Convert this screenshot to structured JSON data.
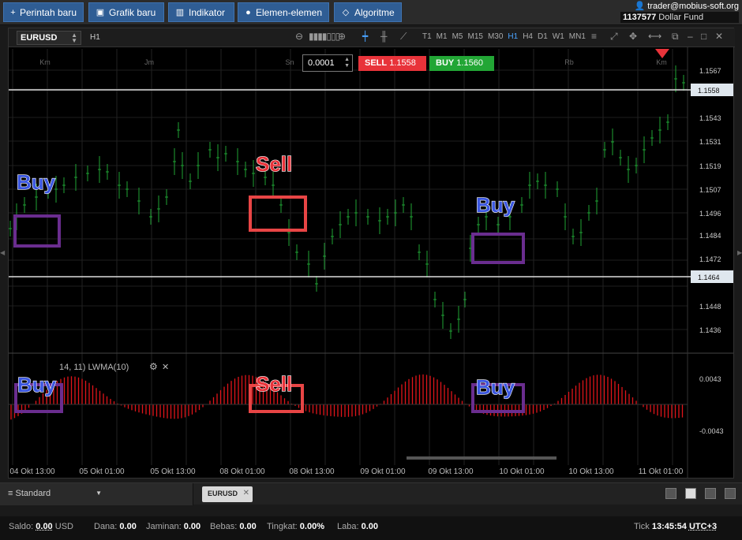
{
  "toolbar": {
    "buttons": [
      {
        "label": "Perintah baru",
        "icon": "plus-icon"
      },
      {
        "label": "Grafik baru",
        "icon": "chart-icon"
      },
      {
        "label": "Indikator",
        "icon": "bars-icon"
      },
      {
        "label": "Elemen-elemen",
        "icon": "shapes-icon"
      },
      {
        "label": "Algoritme",
        "icon": "diamond-icon"
      }
    ]
  },
  "account": {
    "email": "trader@mobius-soft.org",
    "number": "1137577",
    "fund": "Dollar Fund"
  },
  "chart": {
    "symbol": "EURUSD",
    "timeframe": "H1",
    "timeframes": [
      "T1",
      "M1",
      "M5",
      "M15",
      "M30",
      "H1",
      "H4",
      "D1",
      "W1",
      "MN1"
    ],
    "active_timeframe": "H1",
    "lot": "0.0001",
    "sell_label": "SELL",
    "sell_price": "1.1558",
    "buy_label": "BUY",
    "buy_price": "1.1560",
    "day_labels": [
      "Km",
      "Jm",
      "Sn",
      "Rb",
      "Km"
    ],
    "price_ticks": [
      "1.1567",
      "1.1543",
      "1.1531",
      "1.1519",
      "1.1507",
      "1.1496",
      "1.1484",
      "1.1472",
      "1.1448",
      "1.1436"
    ],
    "hline_upper": "1.1558",
    "hline_lower": "1.1464",
    "indicator_label": "14, 11) LWMA(10)",
    "indicator_ticks": [
      "0.0043",
      "-0.0043"
    ],
    "time_labels": [
      "04 Okt 13:00",
      "05 Okt 01:00",
      "05 Okt 13:00",
      "08 Okt 01:00",
      "08 Okt 13:00",
      "09 Okt 01:00",
      "09 Okt 13:00",
      "10 Okt 01:00",
      "10 Okt 13:00",
      "11 Okt 01:00"
    ],
    "annotations": [
      "Buy",
      "Sell",
      "Buy",
      "Buy",
      "Sell",
      "Buy"
    ],
    "colors": {
      "up": "#1fa335",
      "sell": "#e8333a",
      "buy": "#22a635",
      "osc": "#e0141a",
      "buy_text": "#3b57e0",
      "sell_text": "#e8333a",
      "buy_box": "#6a2d8f",
      "sell_box": "#e84545"
    }
  },
  "bottom": {
    "workspace": "Standard",
    "tab": "EURUSD"
  },
  "status": {
    "saldo_label": "Saldo:",
    "saldo_value": "0.00",
    "saldo_currency": "USD",
    "dana_label": "Dana:",
    "dana_value": "0.00",
    "jaminan_label": "Jaminan:",
    "jaminan_value": "0.00",
    "bebas_label": "Bebas:",
    "bebas_value": "0.00",
    "tingkat_label": "Tingkat:",
    "tingkat_value": "0.00%",
    "laba_label": "Laba:",
    "laba_value": "0.00",
    "tick_label": "Tick",
    "time": "13:45:54",
    "timezone": "UTC+3"
  }
}
